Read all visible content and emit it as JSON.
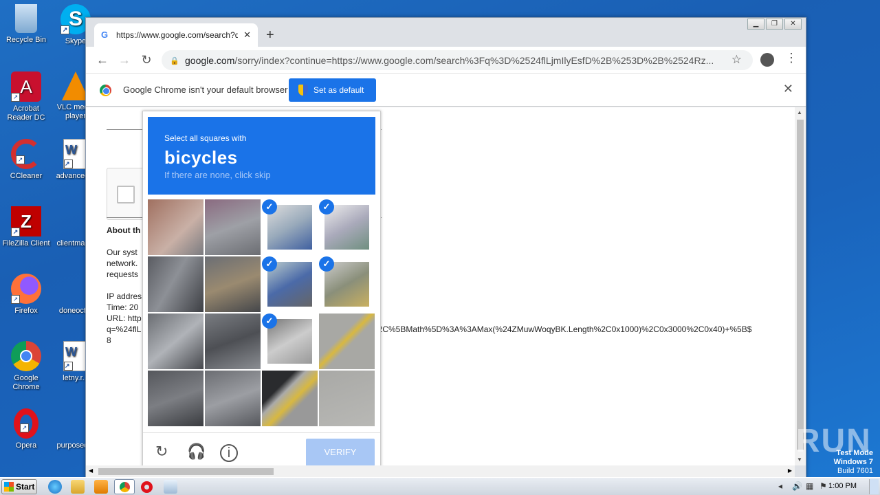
{
  "desktop": {
    "icons": [
      {
        "label": "Recycle Bin",
        "name": "recycle-bin"
      },
      {
        "label": "Skype",
        "name": "skype"
      },
      {
        "label": "Acrobat Reader DC",
        "name": "acrobat"
      },
      {
        "label": "VLC media player",
        "name": "vlc"
      },
      {
        "label": "CCleaner",
        "name": "ccleaner"
      },
      {
        "label": "advanced...",
        "name": "advanced-doc"
      },
      {
        "label": "FileZilla Client",
        "name": "filezilla"
      },
      {
        "label": "clientmail...",
        "name": "clientmail"
      },
      {
        "label": "Firefox",
        "name": "firefox"
      },
      {
        "label": "doneoct...",
        "name": "doneoct"
      },
      {
        "label": "Google Chrome",
        "name": "chrome"
      },
      {
        "label": "letny.r...",
        "name": "letny-doc"
      },
      {
        "label": "Opera",
        "name": "opera"
      },
      {
        "label": "purposed...",
        "name": "purposed"
      }
    ]
  },
  "browser": {
    "tab_title": "https://www.google.com/search?q=",
    "new_tab": "+",
    "url_domain": "google.com",
    "url_rest": "/sorry/index?continue=https://www.google.com/search%3Fq%3D%2524flLjmIlyEsfD%2B%253D%2B%2524Rz...",
    "infobar_message": "Google Chrome isn't your default browser",
    "set_default_label": "Set as default"
  },
  "page": {
    "about_heading": "About th",
    "lines": [
      "Our syst",
      "network.",
      "requests"
    ],
    "ip_label": "IP addres",
    "time_label": "Time: 20",
    "url_label": "URL: http",
    "url_value_start": "q=%24flL",
    "url_value_end": "%2C%5BMath%5D%3A%3AMax(%24ZMuwWoqyBK.Length%2C0x1000)%2C0x3000%2C0x40)+%5B$",
    "url_value_last": "8"
  },
  "captcha": {
    "instruction": "Select all squares with",
    "target": "bicycles",
    "hint": "If there are none, click skip",
    "verify_label": "VERIFY",
    "selected_tiles": [
      2,
      3,
      6,
      7,
      10
    ]
  },
  "taskbar": {
    "start_label": "Start",
    "clock": "1:00 PM"
  },
  "watermark": {
    "line1": "Test Mode",
    "line2": "Windows 7",
    "line3": "Build 7601",
    "brand": "ANY RUN"
  }
}
